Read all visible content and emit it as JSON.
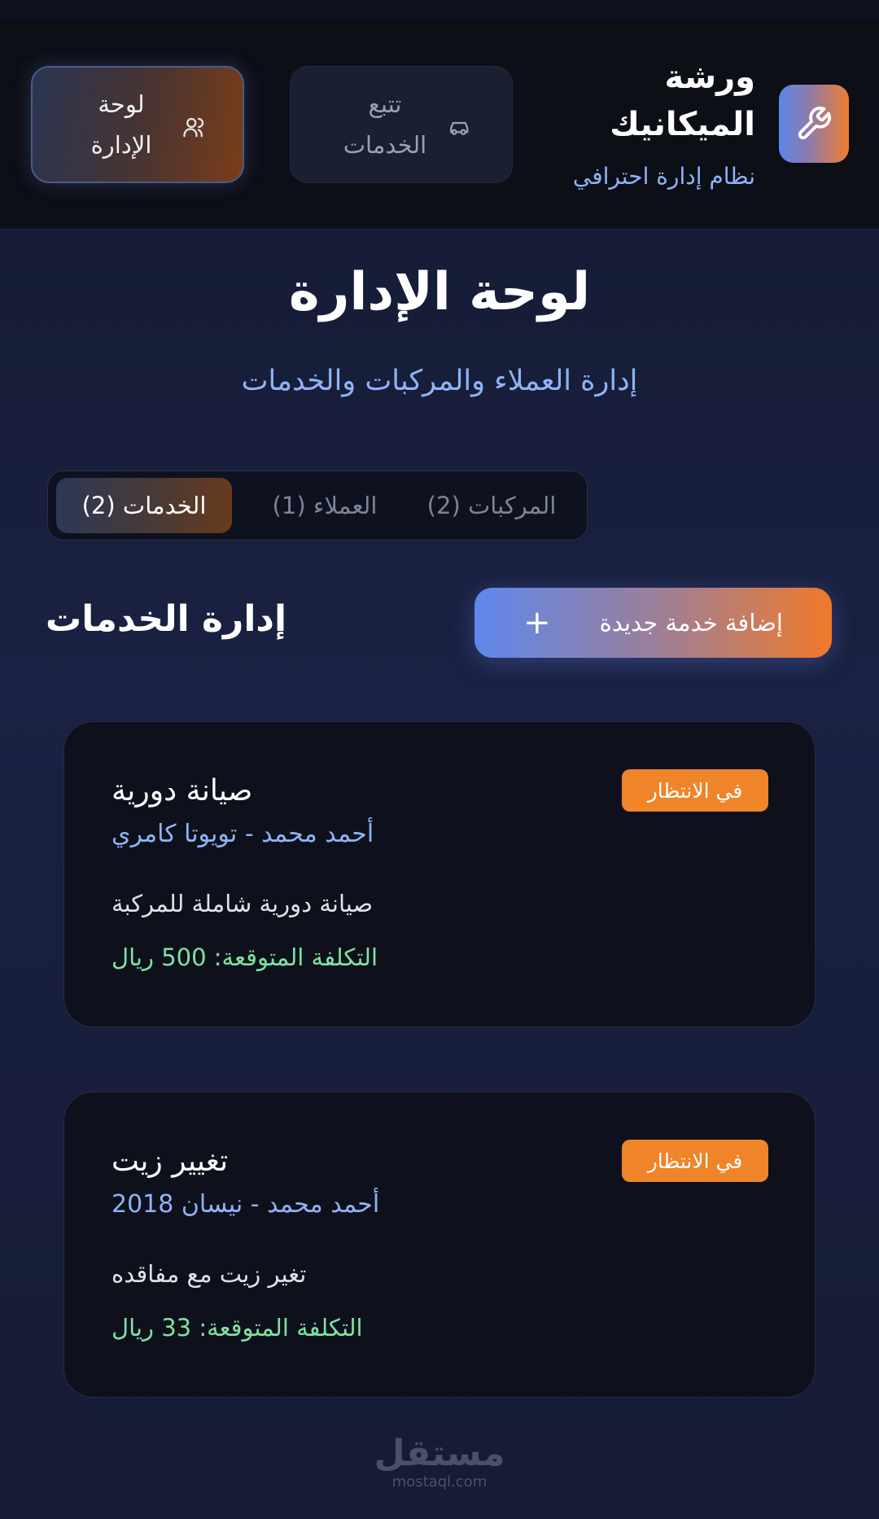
{
  "header": {
    "brand_title": "ورشة الميكانيك",
    "brand_subtitle": "نظام إدارة احترافي",
    "brand_icon": "wrench-icon",
    "nav": [
      {
        "label": "تتبع الخدمات",
        "icon": "car-icon"
      },
      {
        "label": "لوحة الإدارة",
        "icon": "users-icon"
      }
    ]
  },
  "page": {
    "title": "لوحة الإدارة",
    "subtitle": "إدارة العملاء والمركبات والخدمات"
  },
  "tabs": [
    {
      "label": "المركبات (2)"
    },
    {
      "label": "العملاء (1)"
    },
    {
      "label": "الخدمات (2)",
      "active": true
    }
  ],
  "section": {
    "title": "إدارة الخدمات",
    "add_button": "إضافة خدمة جديدة",
    "add_icon": "plus-icon"
  },
  "services": [
    {
      "title": "صيانة دورية",
      "meta": "أحمد محمد - تويوتا كامري",
      "description": "صيانة دورية شاملة للمركبة",
      "cost": "التكلفة المتوقعة: 500 ريال",
      "status": "في الانتظار"
    },
    {
      "title": "تغيير زيت",
      "meta": "أحمد محمد - نيسان 2018",
      "description": "تغير زيت مع مفاقده",
      "cost": "التكلفة المتوقعة: 33 ريال",
      "status": "في الانتظار"
    }
  ],
  "watermark": {
    "logo": "مستقل",
    "url": "mostaql.com"
  },
  "colors": {
    "accent_blue": "#5e88ec",
    "accent_orange": "#f07a2a",
    "status_pending": "#f08428",
    "cost_green": "#7fe3a2",
    "subtitle_blue": "#8fb3f5"
  }
}
